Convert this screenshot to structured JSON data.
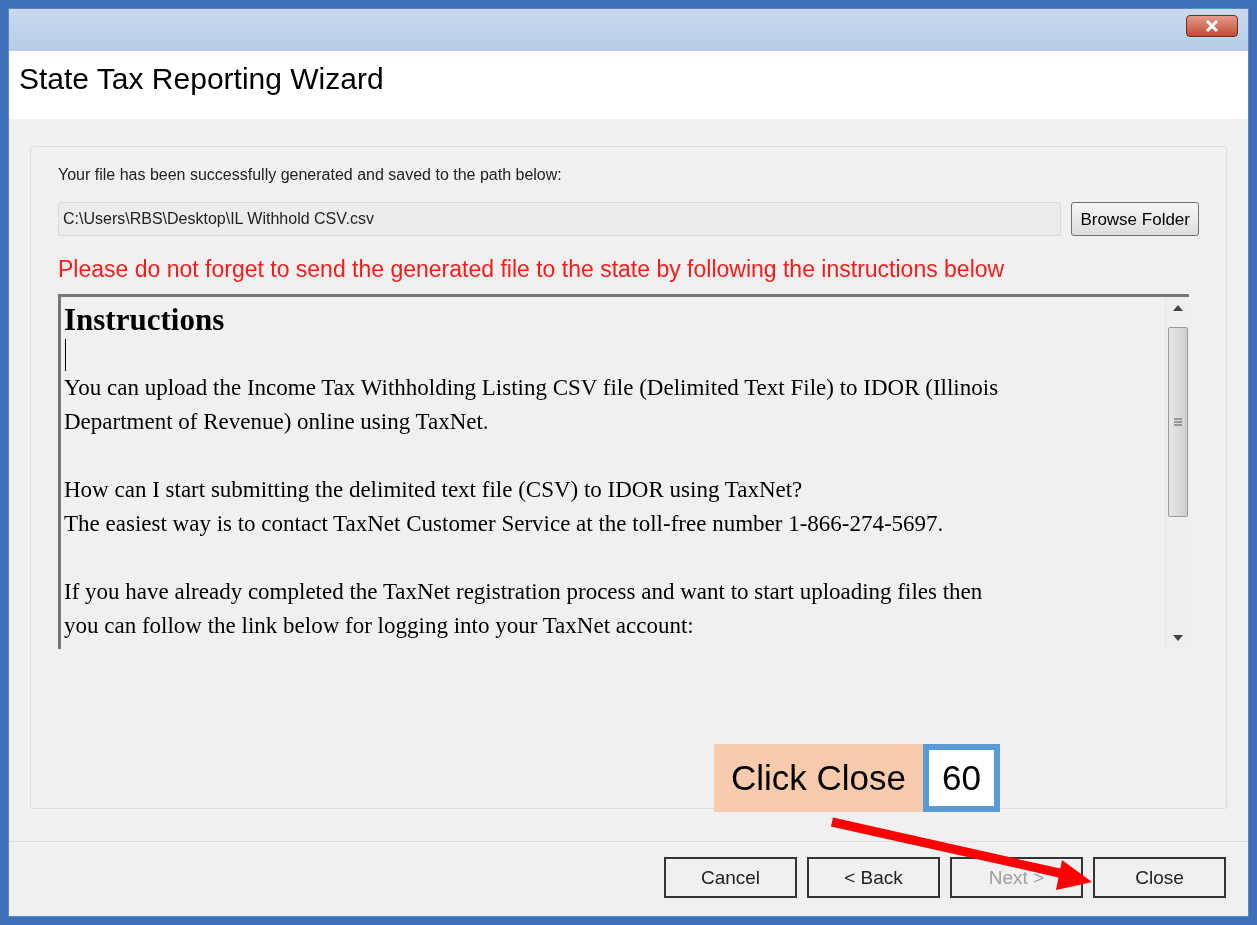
{
  "window": {
    "title": "State Tax Reporting Wizard"
  },
  "message": "Your file has been successfully generated and saved to the path below:",
  "path_field": {
    "value": "C:\\Users\\RBS\\Desktop\\IL Withhold CSV.csv"
  },
  "browse_button": "Browse Folder",
  "warning": "Please do not forget to send the generated file to the state by following the instructions below",
  "instructions": {
    "heading": "Instructions",
    "paragraphs": [
      [
        "You can upload the Income Tax Withholding Listing CSV file (Delimited Text File) to IDOR (Illinois",
        "Department of Revenue) online using TaxNet."
      ],
      [
        "How can I start submitting the delimited text file (CSV) to IDOR using TaxNet?",
        "The easiest way is to contact TaxNet Customer Service at the toll-free number 1-866-274-5697."
      ],
      [
        "If you have already completed the TaxNet registration process and want to start uploading files then",
        "you can follow the link below for logging into your TaxNet account:"
      ]
    ]
  },
  "callout": {
    "label": "Click Close",
    "step": "60"
  },
  "buttons": [
    {
      "label": "Cancel",
      "disabled": false
    },
    {
      "label": "< Back",
      "disabled": false
    },
    {
      "label": "Next >",
      "disabled": true
    },
    {
      "label": "Close",
      "disabled": false
    }
  ]
}
